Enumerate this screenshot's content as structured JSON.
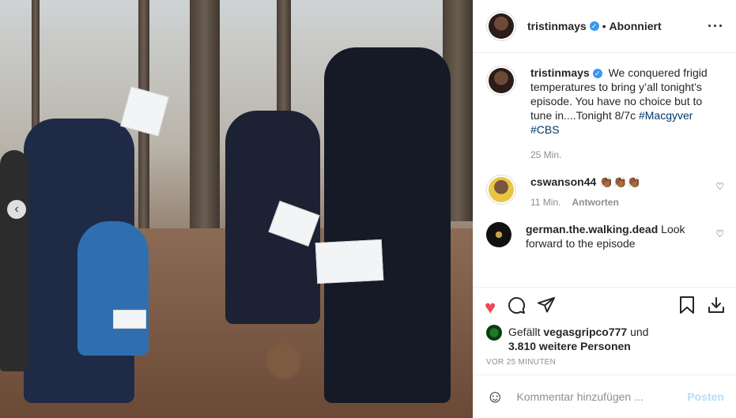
{
  "header": {
    "username": "tristinmays",
    "follow_status": "Abonniert",
    "more_icon": "more-horizontal-icon"
  },
  "caption": {
    "username": "tristinmays",
    "text_before": " We conquered frigid temperatures to bring y’all tonight’s episode. You have no choice but to tune in....Tonight 8/7c ",
    "hashtag1": "#Macgyver",
    "hashtag2": "#CBS",
    "time": "25 Min."
  },
  "comments": [
    {
      "username": "cswanson44",
      "text": "👏🏾👏🏾👏🏾",
      "time": "11 Min.",
      "reply_label": "Antworten"
    },
    {
      "username": "german.the.walking.dead",
      "text": "Look forward to the episode"
    }
  ],
  "actions": {
    "like_icon": "heart-filled-icon",
    "comment_icon": "comment-icon",
    "share_icon": "paper-plane-icon",
    "save_icon": "bookmark-icon",
    "download_icon": "download-icon",
    "like_color": "#ed4956"
  },
  "likes": {
    "prefix": "Gefällt ",
    "user": "vegasgripco777",
    "middle": " und",
    "count_text": "3.810 weitere Personen"
  },
  "timestamp": "VOR 25 MINUTEN",
  "add_comment": {
    "placeholder": "Kommentar hinzufügen ...",
    "post_label": "Posten"
  }
}
